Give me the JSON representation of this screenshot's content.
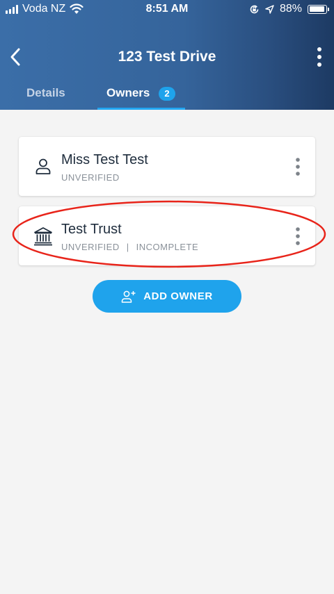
{
  "status_bar": {
    "carrier": "Voda NZ",
    "time": "8:51 AM",
    "battery": "88%"
  },
  "nav": {
    "title": "123 Test Drive"
  },
  "tabs": [
    {
      "label": "Details",
      "active": false
    },
    {
      "label": "Owners",
      "active": true,
      "badge": "2"
    }
  ],
  "owners": [
    {
      "name": "Miss Test Test",
      "status": "UNVERIFIED",
      "icon": "person-icon"
    },
    {
      "name": "Test Trust",
      "status": "UNVERIFIED",
      "status_extra": "INCOMPLETE",
      "separator": "|",
      "icon": "bank-icon",
      "highlighted": true
    }
  ],
  "add_owner": {
    "label": "ADD OWNER",
    "icon": "add-person-icon"
  },
  "colors": {
    "header_start": "#3b6ea8",
    "header_end": "#1d3a63",
    "accent": "#1fa3ec",
    "highlight": "#e8241a",
    "background": "#f4f4f4"
  }
}
